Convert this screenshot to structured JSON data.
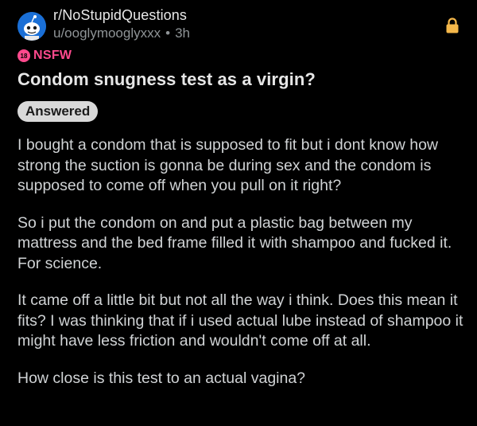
{
  "post": {
    "subreddit": "r/NoStupidQuestions",
    "author": "u/ooglymooglyxxx",
    "separator": "•",
    "age": "3h",
    "nsfw_label": "NSFW",
    "nsfw_icon_text": "18",
    "title": "Condom snugness test as a virgin?",
    "flair": "Answered",
    "paragraphs": [
      "I bought a condom that is supposed to fit but i dont know how strong the suction is gonna be during sex and the condom is supposed to come off when you pull on it right?",
      "So i put the condom on and put a plastic bag between my mattress and the bed frame filled it with shampoo and fucked it. For science.",
      "It came off a little bit but not all the way i think. Does this mean it fits? I was thinking that if i used actual lube instead of shampoo it might have less friction and wouldn't come off at all.",
      "How close is this test to an actual vagina?"
    ]
  },
  "icons": {
    "avatar": "snoo-avatar-icon",
    "lock": "lock-icon",
    "nsfw": "nsfw-18-icon"
  },
  "colors": {
    "background": "#000000",
    "nsfw": "#ff4a8d",
    "lock": "#f5b84a",
    "flair_bg": "#d9d9d9",
    "avatar_bg": "#1a6fd6"
  }
}
